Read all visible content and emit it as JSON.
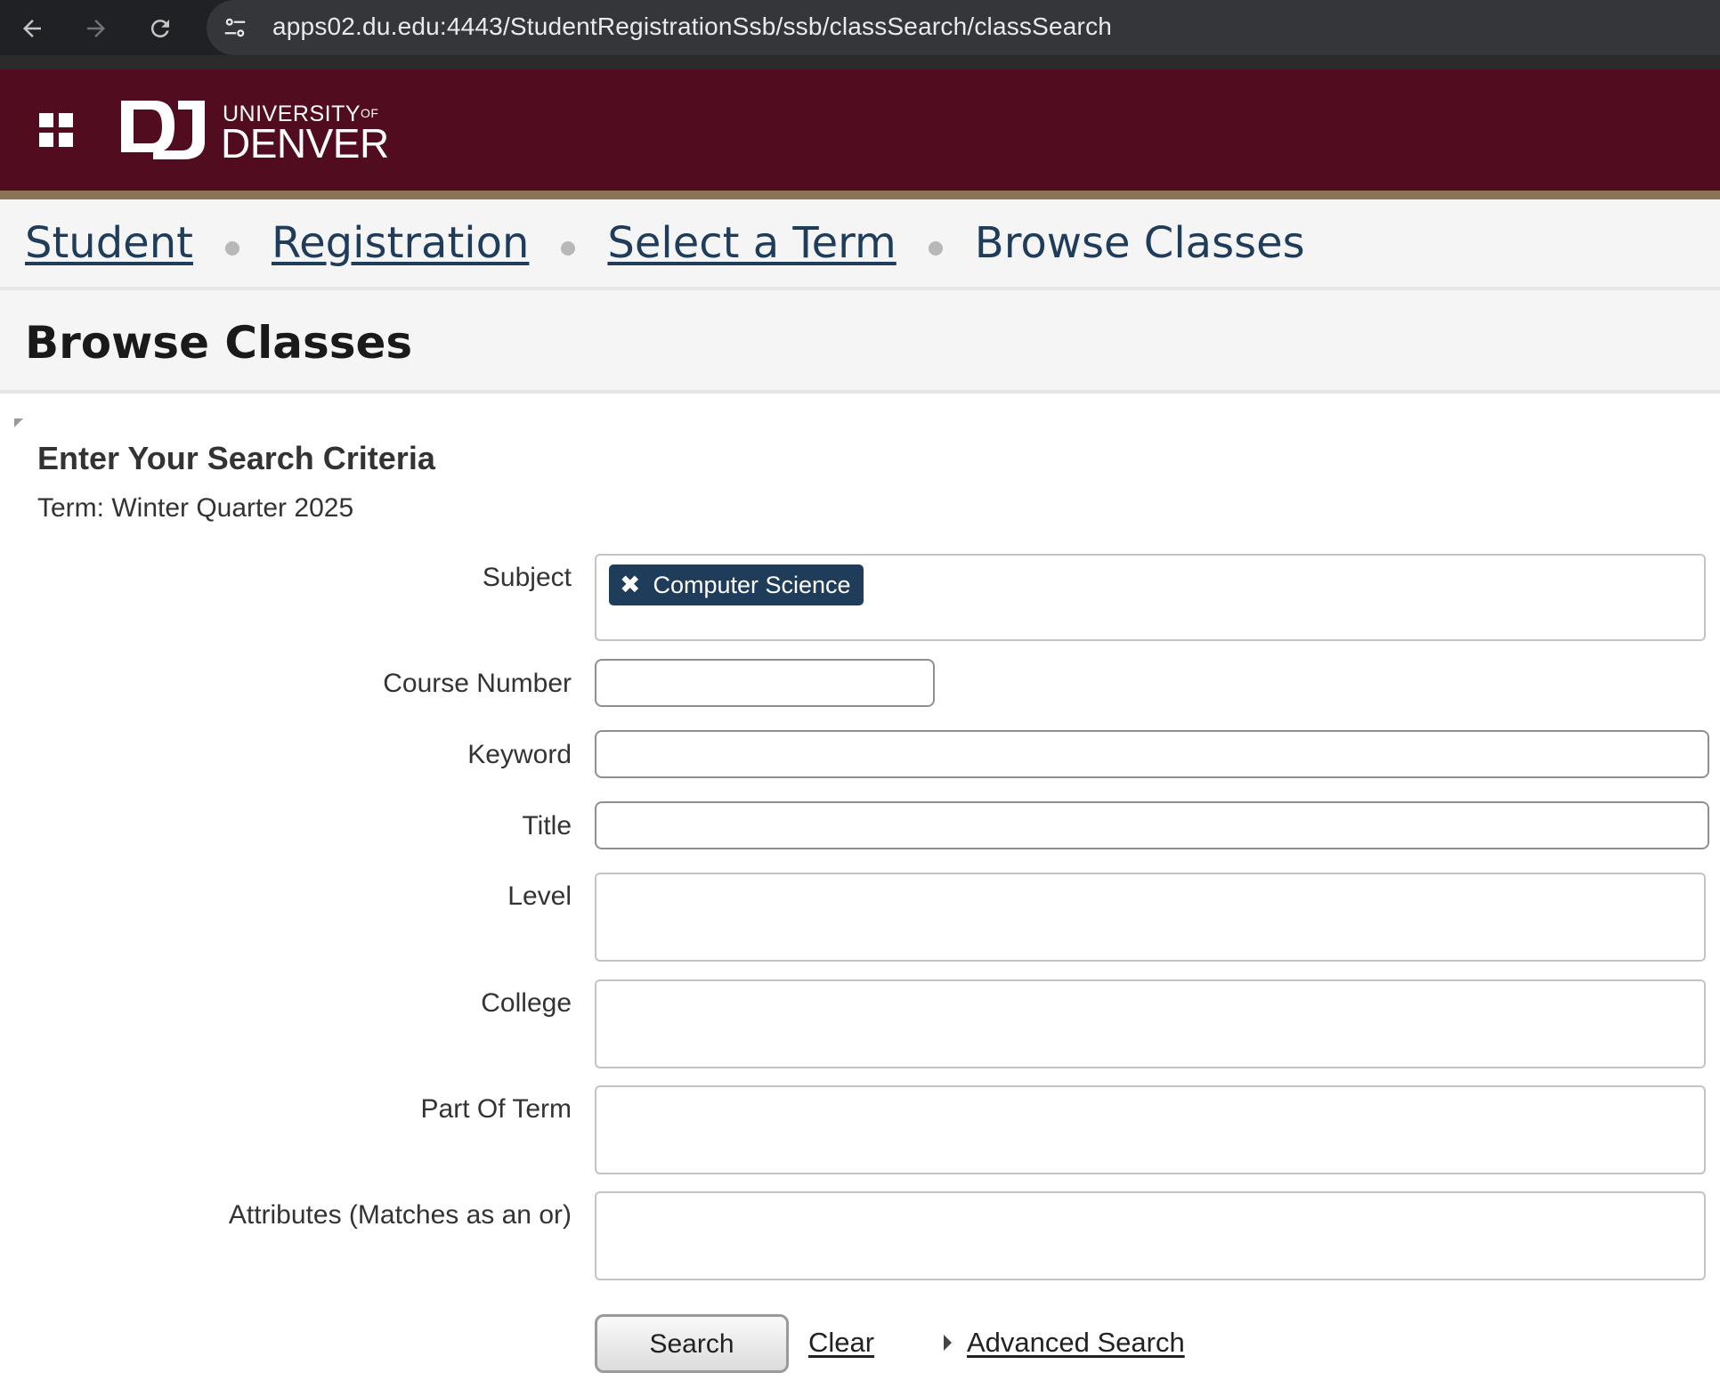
{
  "browser": {
    "url": "apps02.du.edu:4443/StudentRegistrationSsb/ssb/classSearch/classSearch"
  },
  "header": {
    "logo_text_top": "UNIVERSITY",
    "logo_text_of": "OF",
    "logo_text_main": "DENVER",
    "brand_color": "#520c1f"
  },
  "breadcrumb": {
    "items": [
      "Student",
      "Registration",
      "Select a Term"
    ],
    "current": "Browse Classes"
  },
  "page": {
    "title": "Browse Classes"
  },
  "form": {
    "heading": "Enter Your Search Criteria",
    "term": "Term: Winter Quarter 2025",
    "fields": {
      "subject": {
        "label": "Subject",
        "selected": "Computer Science"
      },
      "course_number": {
        "label": "Course Number",
        "value": ""
      },
      "keyword": {
        "label": "Keyword",
        "value": ""
      },
      "title": {
        "label": "Title",
        "value": ""
      },
      "level": {
        "label": "Level"
      },
      "college": {
        "label": "College"
      },
      "part_of_term": {
        "label": "Part Of Term"
      },
      "attributes": {
        "label": "Attributes (Matches as an or)"
      }
    },
    "buttons": {
      "search": "Search",
      "clear": "Clear",
      "advanced": "Advanced Search"
    }
  }
}
